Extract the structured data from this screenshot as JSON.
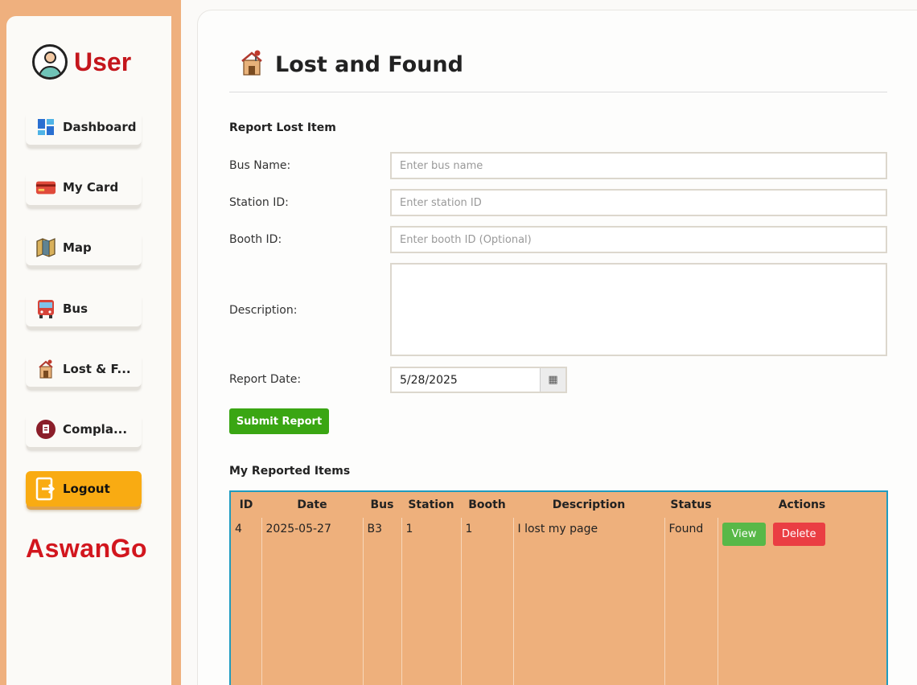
{
  "sidebar": {
    "brand_title": "User",
    "items": [
      {
        "label": "Dashboard",
        "icon": "dashboard-icon"
      },
      {
        "label": "My Card",
        "icon": "card-icon"
      },
      {
        "label": "Map",
        "icon": "map-icon"
      },
      {
        "label": "Bus",
        "icon": "bus-icon"
      },
      {
        "label": "Lost & F...",
        "icon": "lost-found-icon"
      },
      {
        "label": "Compla...",
        "icon": "complaint-icon"
      }
    ],
    "logout_label": "Logout",
    "footer_brand": "AswanGo"
  },
  "page": {
    "title": "Lost and Found"
  },
  "form": {
    "section_title": "Report Lost Item",
    "bus_name_label": "Bus Name:",
    "bus_name_placeholder": "Enter bus name",
    "station_id_label": "Station ID:",
    "station_id_placeholder": "Enter station ID",
    "booth_id_label": "Booth ID:",
    "booth_id_placeholder": "Enter booth ID (Optional)",
    "description_label": "Description:",
    "report_date_label": "Report Date:",
    "report_date_value": "5/28/2025",
    "submit_label": "Submit Report"
  },
  "reports": {
    "section_title": "My Reported Items",
    "columns": [
      "ID",
      "Date",
      "Bus",
      "Station",
      "Booth",
      "Description",
      "Status",
      "Actions"
    ],
    "rows": [
      {
        "id": "4",
        "date": "2025-05-27",
        "bus": "B3",
        "station": "1",
        "booth": "1",
        "description": "I lost my page",
        "status": "Found"
      }
    ],
    "view_label": "View",
    "delete_label": "Delete"
  },
  "colors": {
    "brand_red": "#c4161c",
    "accent_orange": "#efb07e",
    "logout_yellow": "#f9ab12",
    "submit_green": "#3aa613",
    "view_green": "#58b848",
    "delete_red": "#ea3e43"
  }
}
